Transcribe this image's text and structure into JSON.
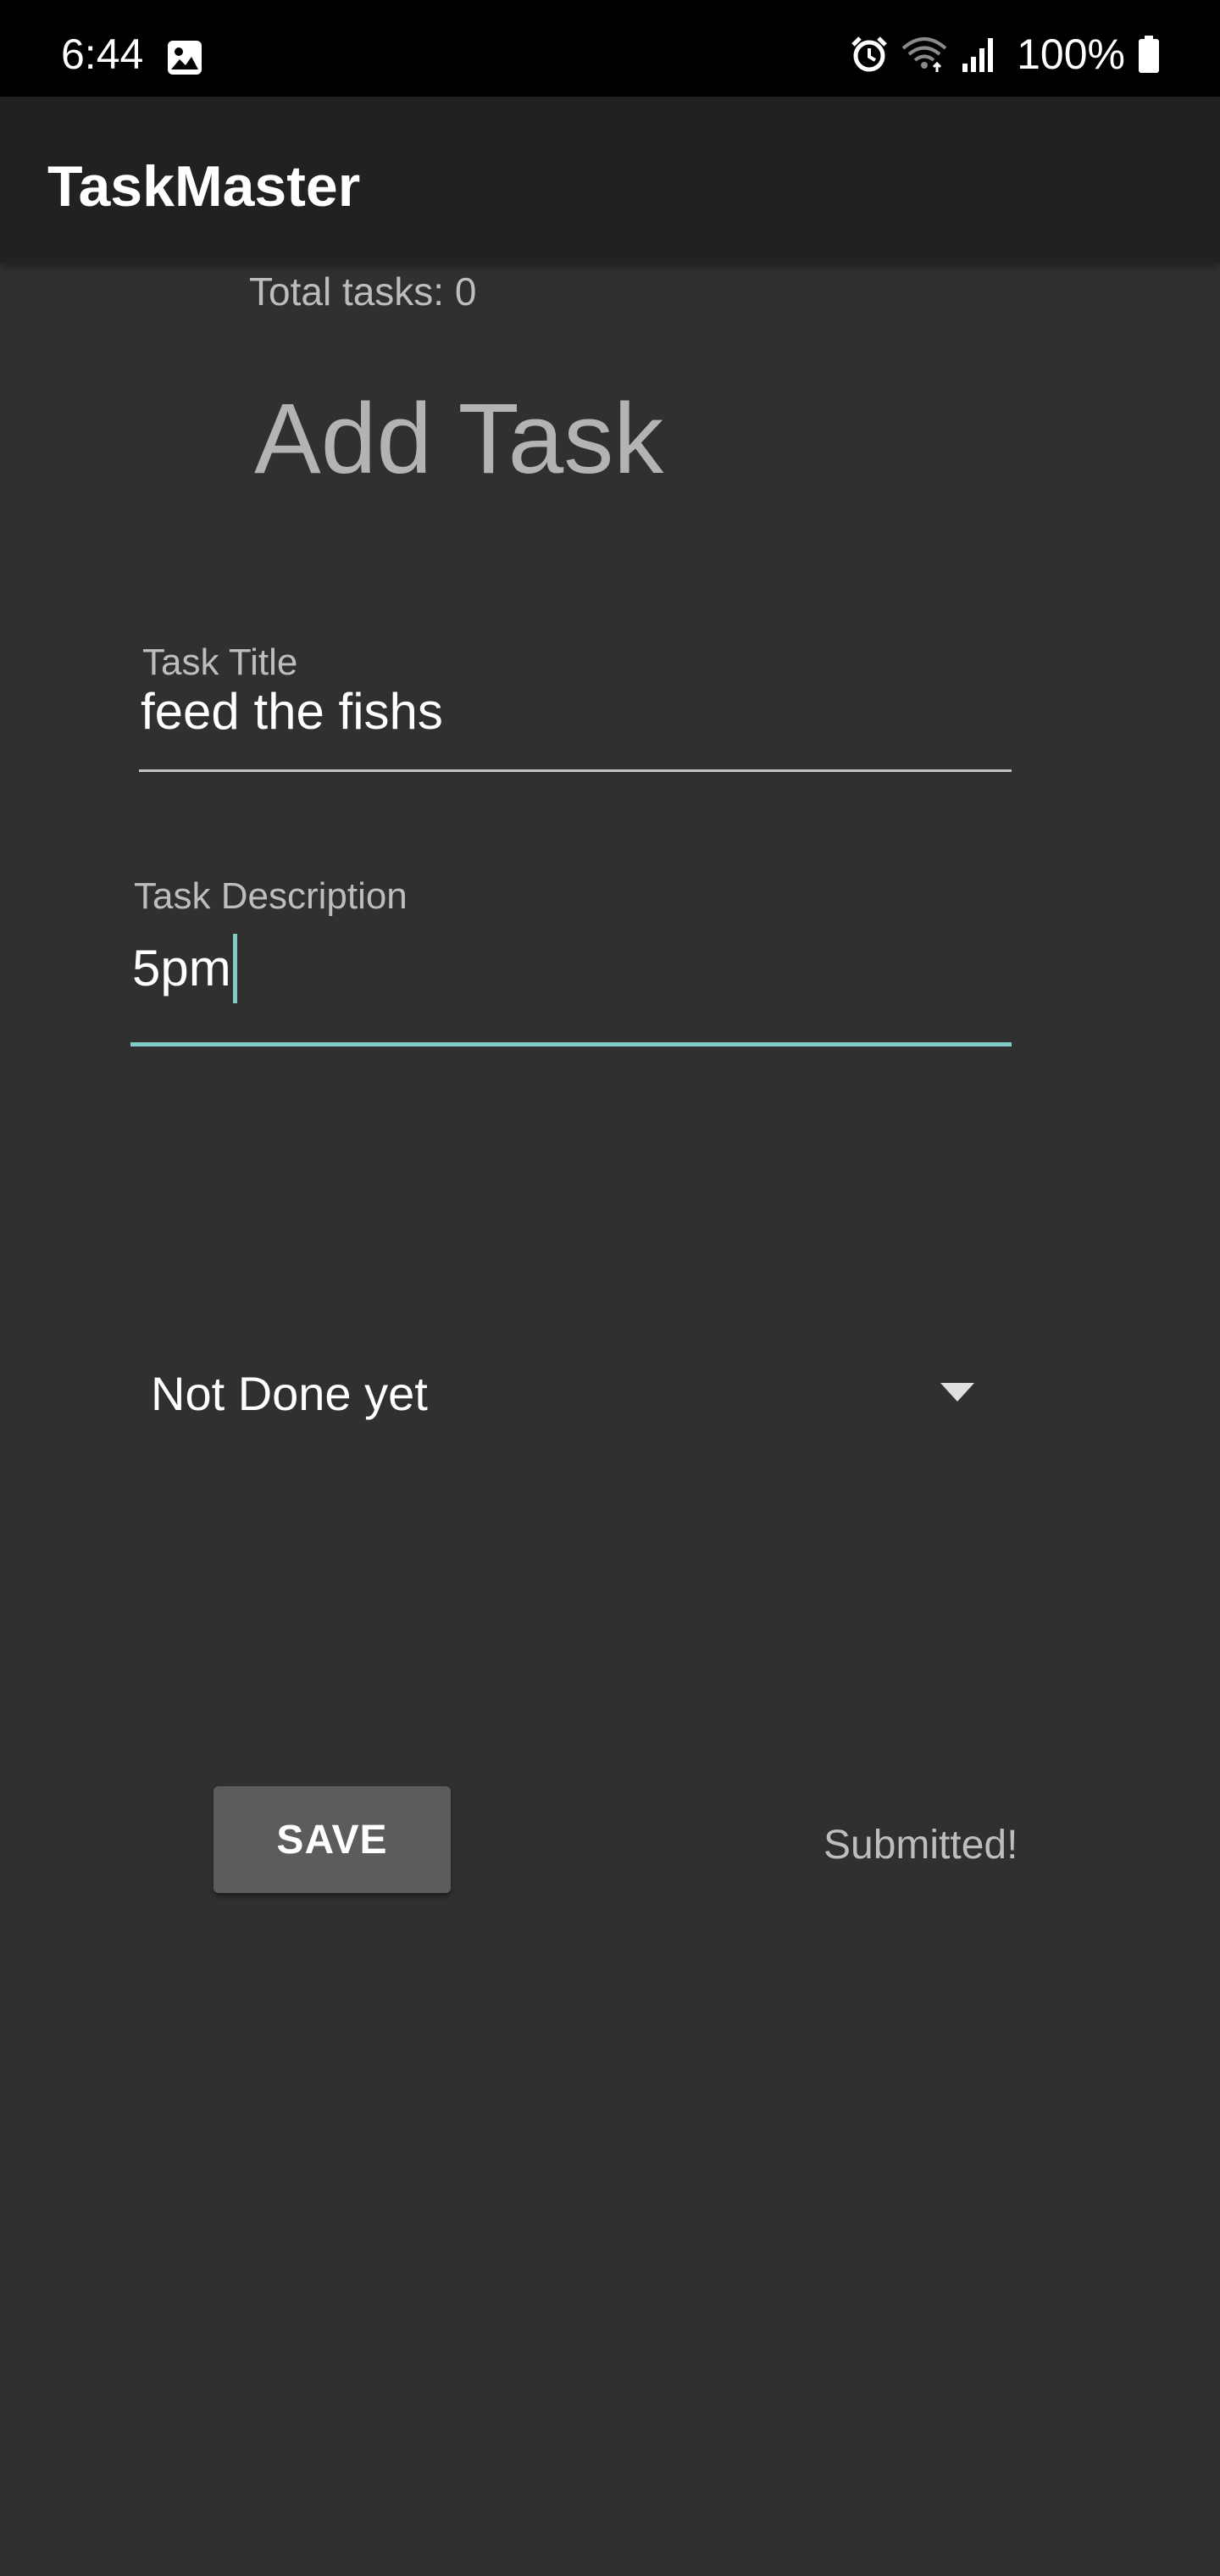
{
  "status_bar": {
    "time": "6:44",
    "battery": "100%",
    "icons": [
      "image-icon",
      "alarm-icon",
      "wifi-icon",
      "signal-icon",
      "battery-icon"
    ]
  },
  "app_bar": {
    "title": "TaskMaster"
  },
  "main": {
    "total_tasks": "Total tasks: 0",
    "heading": "Add Task",
    "title_field": {
      "label": "Task Title",
      "value": "feed the fishs"
    },
    "description_field": {
      "label": "Task Description",
      "value": "5pm"
    },
    "status_spinner": {
      "selected": "Not Done yet"
    },
    "save_label": "SAVE",
    "submitted_text": "Submitted!"
  },
  "colors": {
    "background": "#303030",
    "app_bar": "#212121",
    "status_bar": "#000000",
    "accent": "#80cbc4",
    "button": "#5c5c5f"
  }
}
